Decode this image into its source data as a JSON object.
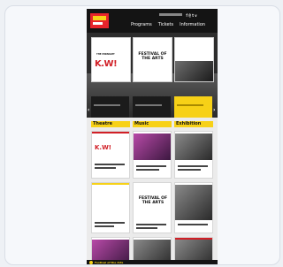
{
  "header": {
    "logo_text": "",
    "utility": "f@tv",
    "nav": [
      "Programs",
      "Tickets",
      "Information"
    ]
  },
  "hero": {
    "posters": [
      {
        "headline": "K.W!",
        "subline": "THE MIDNIGHT"
      },
      {
        "headline": "FESTIVAL OF THE ARTS",
        "subline": ""
      },
      {
        "headline": "",
        "subline": ""
      }
    ],
    "captions": [
      {
        "title": "",
        "style": "dark"
      },
      {
        "title": "",
        "style": "dark"
      },
      {
        "title": "",
        "style": "yellow"
      }
    ],
    "arrows": {
      "prev": "‹",
      "next": "›"
    }
  },
  "categories": [
    {
      "label": "Theatre"
    },
    {
      "label": "Music"
    },
    {
      "label": "Exhibition"
    }
  ],
  "tiles": {
    "c1_t1": {
      "headline": "K.W!"
    },
    "c2_t2": {
      "headline": "FESTIVAL OF THE ARTS"
    },
    "c1_t2": {
      "headline": ""
    }
  },
  "footer": {
    "text": "Festival of the Arts"
  },
  "colors": {
    "accent_yellow": "#f7d117",
    "accent_red": "#d11f26",
    "dark": "#141414"
  }
}
